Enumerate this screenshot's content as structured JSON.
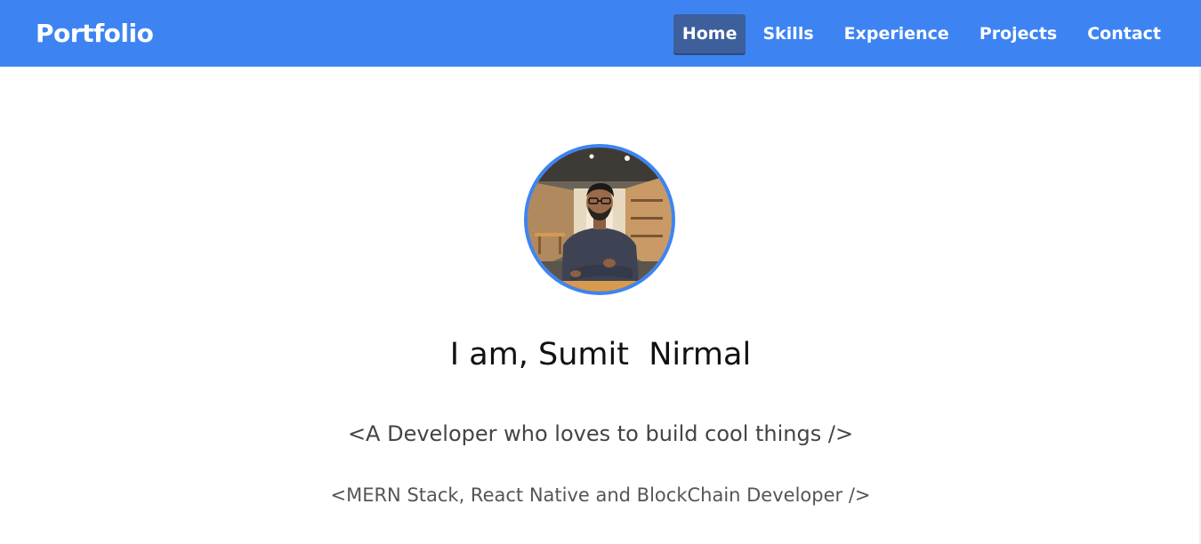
{
  "brand": {
    "title": "Portfolio"
  },
  "nav": {
    "items": [
      {
        "label": "Home",
        "active": true
      },
      {
        "label": "Skills",
        "active": false
      },
      {
        "label": "Experience",
        "active": false
      },
      {
        "label": "Projects",
        "active": false
      },
      {
        "label": "Contact",
        "active": false
      }
    ]
  },
  "hero": {
    "greeting": "I am, Sumit  Nirmal",
    "tagline": "<A Developer who loves to build cool things />",
    "role": "<MERN Stack, React Native and BlockChain Developer />"
  },
  "colors": {
    "navbar": "#3d84f2",
    "nav_active": "#3d5f9c",
    "avatar_border": "#3d84f2"
  }
}
